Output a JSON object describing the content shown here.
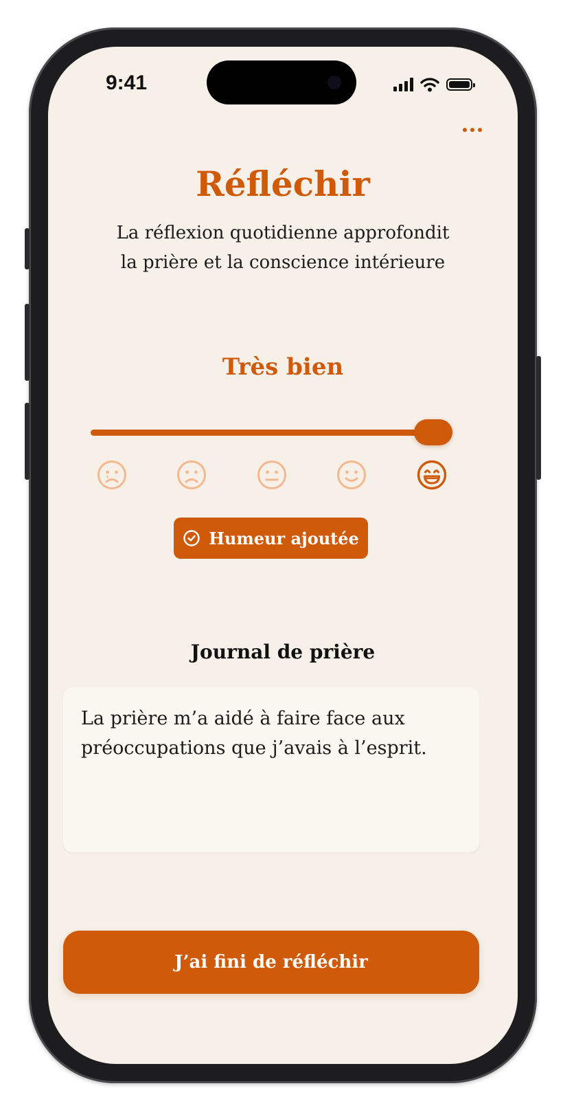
{
  "status_bar": {
    "time": "9:41",
    "icons": [
      "cellular-signal-icon",
      "wifi-icon",
      "battery-icon"
    ]
  },
  "header": {
    "menu_icon": "more-horizontal-icon"
  },
  "page": {
    "title": "Réfléchir",
    "subtitle_lines": [
      "La réflexion quotidienne approfondit",
      "la prière et la conscience intérieure"
    ]
  },
  "mood": {
    "label": "Très bien",
    "level": 5,
    "level_max": 5,
    "faces": [
      "tearful-face-icon",
      "frowning-face-icon",
      "neutral-face-icon",
      "smiling-face-icon",
      "grinning-face-icon"
    ],
    "selected_index": 4,
    "added_badge": {
      "icon": "check-circle-icon",
      "label": "Humeur ajoutée"
    }
  },
  "journal": {
    "title": "Journal de prière",
    "text": "La prière m’a aidé à faire face aux préoccupations que j’avais à l’esprit."
  },
  "actions": {
    "finish_label": "J’ai fini de réfléchir"
  },
  "colors": {
    "accent": "#cf5a0a",
    "background": "#f6f0e8",
    "face_inactive": "#f3b88e",
    "journal_bg": "#faf7f1"
  }
}
